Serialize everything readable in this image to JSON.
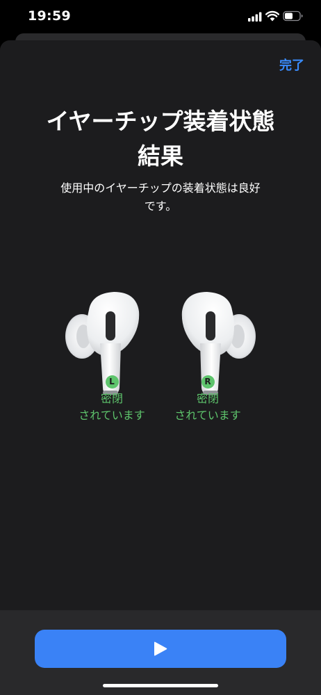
{
  "status_bar": {
    "time": "19:59",
    "icons": [
      "signal-icon",
      "wifi-icon",
      "battery-icon"
    ]
  },
  "header": {
    "done_label": "完了"
  },
  "main": {
    "title": "イヤーチップ装着状態\n結果",
    "subtitle": "使用中のイヤーチップの装着状態は良好\nです。",
    "left": {
      "badge": "L",
      "result": "密閉\nされています"
    },
    "right": {
      "badge": "R",
      "result": "密閉\nされています"
    }
  },
  "footer": {
    "play_icon": "play-icon"
  },
  "colors": {
    "background": "#1c1c1e",
    "accent": "#3a82f6",
    "link": "#3a8cff",
    "success": "#5ec46c"
  }
}
